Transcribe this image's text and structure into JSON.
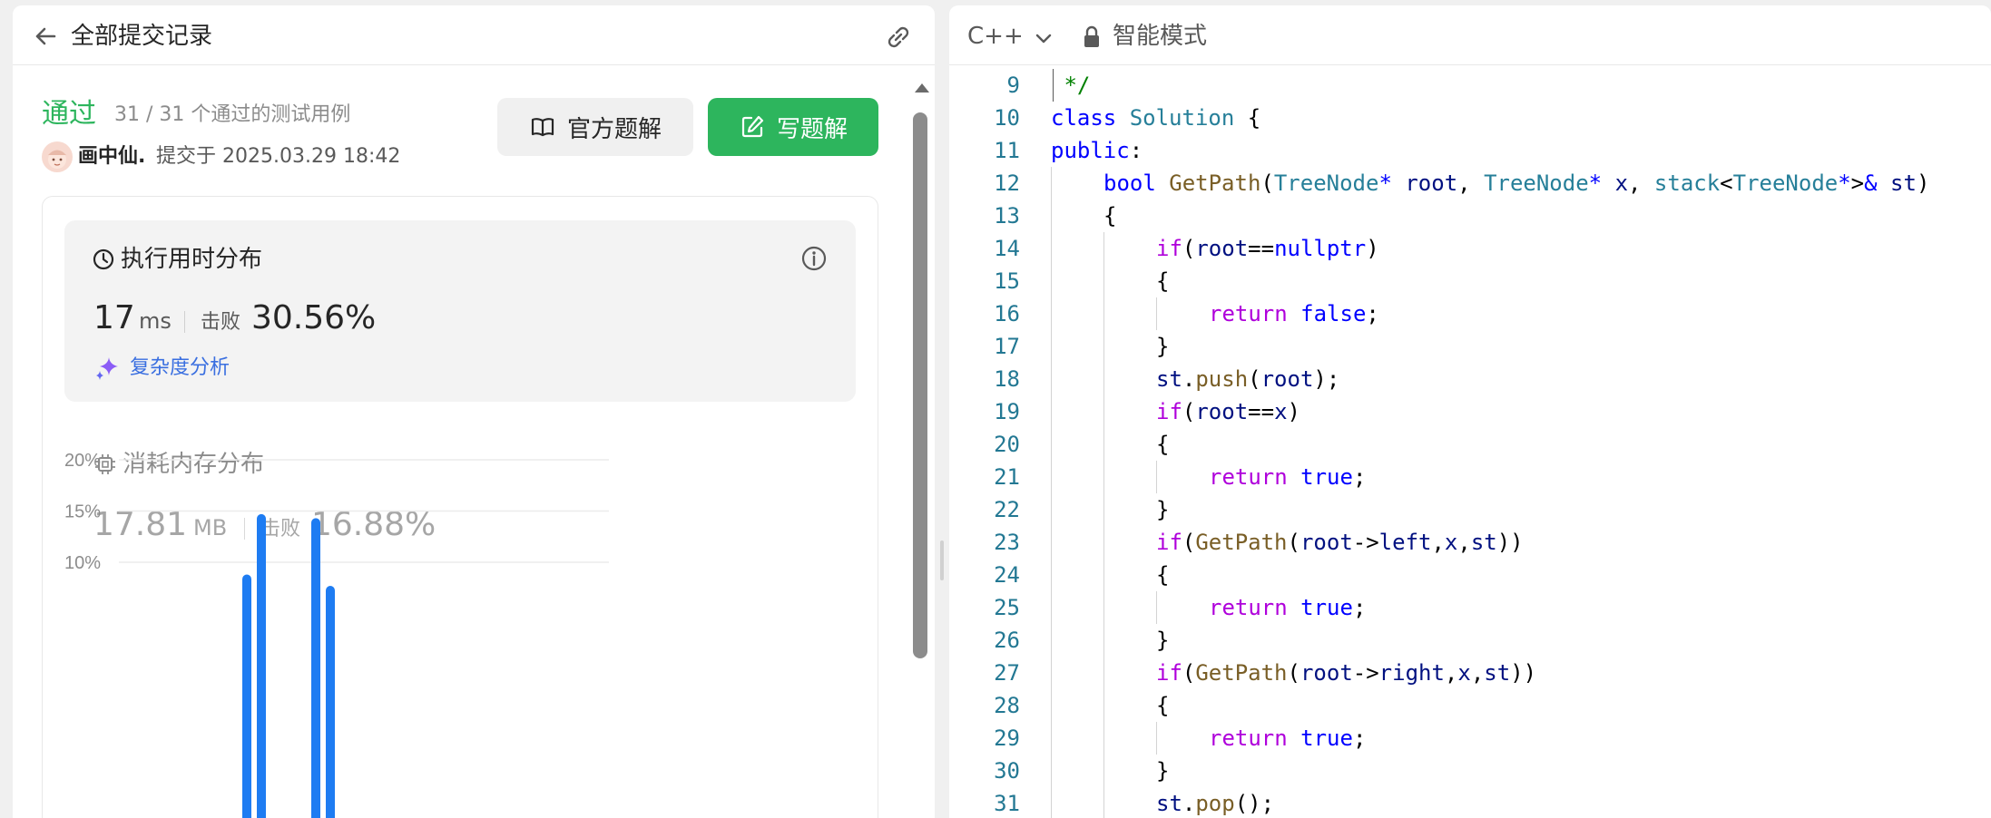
{
  "header": {
    "title": "全部提交记录"
  },
  "submission": {
    "status": "通过",
    "cases": "31 / 31 个通过的测试用例",
    "user": "画中仙.",
    "submitted_at": "提交于 2025.03.29 18:42"
  },
  "actions": {
    "official_solution": "官方题解",
    "write_solution": "写题解"
  },
  "runtime": {
    "title": "执行用时分布",
    "value": "17",
    "unit": "ms",
    "beats_label": "击败",
    "beats_value": "30.56%",
    "complexity_link": "复杂度分析"
  },
  "memory": {
    "title": "消耗内存分布",
    "value": "17.81",
    "unit": "MB",
    "beats_label": "击败",
    "beats_value": "16.88%"
  },
  "chart_data": {
    "type": "bar",
    "y_ticks": [
      "20%",
      "15%",
      "10%"
    ],
    "ylim": [
      0,
      20
    ],
    "bars": [
      {
        "slot": 0,
        "value": 8.8
      },
      {
        "slot": 1,
        "value": 14.7
      },
      {
        "slot": 2,
        "value": 14.3
      },
      {
        "slot": 3,
        "value": 7.7
      }
    ],
    "bar_color": "#1e7cf2"
  },
  "editor": {
    "language": "C++",
    "mode": "智能模式"
  },
  "code": {
    "lines": [
      {
        "no": "9",
        "indent": 0,
        "html": "<span class=\"cm\"> */</span>"
      },
      {
        "no": "10",
        "indent": 0,
        "html": "<span class=\"kw\">class</span> <span class=\"ty\">Solution</span> {"
      },
      {
        "no": "11",
        "indent": 0,
        "html": "<span class=\"kw\">public</span>:"
      },
      {
        "no": "12",
        "indent": 1,
        "html": "<span class=\"kw\">bool</span> <span class=\"fn\">GetPath</span>(<span class=\"ty\">TreeNode</span><span class=\"kw\">*</span> <span class=\"vr\">root</span>, <span class=\"ty\">TreeNode</span><span class=\"kw\">*</span> <span class=\"vr\">x</span>, <span class=\"ty\">stack</span>&lt;<span class=\"ty\">TreeNode</span><span class=\"kw\">*</span>&gt;<span class=\"kw\">&amp;</span> <span class=\"vr\">st</span>)"
      },
      {
        "no": "13",
        "indent": 1,
        "html": "{"
      },
      {
        "no": "14",
        "indent": 2,
        "html": "<span class=\"ctl\">if</span>(<span class=\"vr\">root</span>==<span class=\"kw\">nullptr</span>)"
      },
      {
        "no": "15",
        "indent": 2,
        "html": "{"
      },
      {
        "no": "16",
        "indent": 3,
        "html": "<span class=\"ctl\">return</span> <span class=\"kw\">false</span>;"
      },
      {
        "no": "17",
        "indent": 2,
        "html": "}"
      },
      {
        "no": "18",
        "indent": 2,
        "html": "<span class=\"vr\">st</span>.<span class=\"fn\">push</span>(<span class=\"vr\">root</span>);"
      },
      {
        "no": "19",
        "indent": 2,
        "html": "<span class=\"ctl\">if</span>(<span class=\"vr\">root</span>==<span class=\"vr\">x</span>)"
      },
      {
        "no": "20",
        "indent": 2,
        "html": "{"
      },
      {
        "no": "21",
        "indent": 3,
        "html": "<span class=\"ctl\">return</span> <span class=\"kw\">true</span>;"
      },
      {
        "no": "22",
        "indent": 2,
        "html": "}"
      },
      {
        "no": "23",
        "indent": 2,
        "html": "<span class=\"ctl\">if</span>(<span class=\"fn\">GetPath</span>(<span class=\"vr\">root</span>-&gt;<span class=\"vr\">left</span>,<span class=\"vr\">x</span>,<span class=\"vr\">st</span>))"
      },
      {
        "no": "24",
        "indent": 2,
        "html": "{"
      },
      {
        "no": "25",
        "indent": 3,
        "html": "<span class=\"ctl\">return</span> <span class=\"kw\">true</span>;"
      },
      {
        "no": "26",
        "indent": 2,
        "html": "}"
      },
      {
        "no": "27",
        "indent": 2,
        "html": "<span class=\"ctl\">if</span>(<span class=\"fn\">GetPath</span>(<span class=\"vr\">root</span>-&gt;<span class=\"vr\">right</span>,<span class=\"vr\">x</span>,<span class=\"vr\">st</span>))"
      },
      {
        "no": "28",
        "indent": 2,
        "html": "{"
      },
      {
        "no": "29",
        "indent": 3,
        "html": "<span class=\"ctl\">return</span> <span class=\"kw\">true</span>;"
      },
      {
        "no": "30",
        "indent": 2,
        "html": "}"
      },
      {
        "no": "31",
        "indent": 2,
        "html": "<span class=\"vr\">st</span>.<span class=\"fn\">pop</span>();"
      }
    ]
  }
}
